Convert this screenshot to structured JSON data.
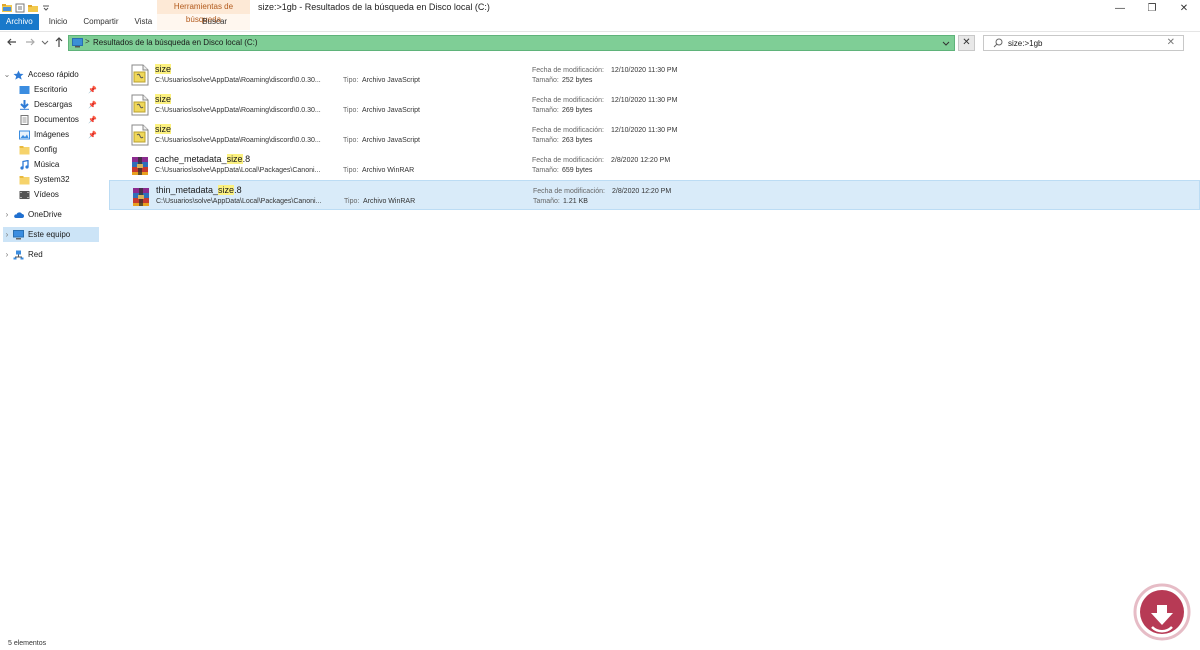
{
  "window": {
    "title": "size:>1gb - Resultados de la búsqueda en Disco local (C:)",
    "controls": [
      "—",
      "❐",
      "✕"
    ]
  },
  "ribbon": {
    "context_group": "Herramientas de búsqueda",
    "tabs": [
      "Archivo",
      "Inicio",
      "Compartir",
      "Vista",
      "Buscar"
    ]
  },
  "addressbar": {
    "path": "Resultados de la búsqueda en Disco local (C:)",
    "close_glyph": "✕"
  },
  "search": {
    "value": "size:>1gb",
    "clear_glyph": "✕"
  },
  "sidebar": {
    "items": [
      {
        "label": "Acceso rápido",
        "icon": "star-icon",
        "pinned": false
      },
      {
        "label": "Escritorio",
        "icon": "desktop-icon",
        "pinned": true
      },
      {
        "label": "Descargas",
        "icon": "download-icon",
        "pinned": true
      },
      {
        "label": "Documentos",
        "icon": "documents-icon",
        "pinned": true
      },
      {
        "label": "Imágenes",
        "icon": "pictures-icon",
        "pinned": true
      },
      {
        "label": "Config",
        "icon": "folder-icon",
        "pinned": false
      },
      {
        "label": "Música",
        "icon": "music-icon",
        "pinned": false
      },
      {
        "label": "System32",
        "icon": "folder-icon",
        "pinned": false
      },
      {
        "label": "Vídeos",
        "icon": "videos-icon",
        "pinned": false
      },
      {
        "label": "OneDrive",
        "icon": "cloud-icon",
        "pinned": false
      },
      {
        "label": "Este equipo",
        "icon": "computer-icon",
        "pinned": false
      },
      {
        "label": "Red",
        "icon": "network-icon",
        "pinned": false
      }
    ]
  },
  "results": {
    "type_label": "Tipo:",
    "date_label": "Fecha de modificación:",
    "size_label": "Tamaño:",
    "items": [
      {
        "name_pre": "",
        "name_hl": "size",
        "name_post": "",
        "path": "C:\\Usuarios\\solve\\AppData\\Roaming\\discord\\0.0.30...",
        "type": "Archivo JavaScript",
        "date": "12/10/2020 11:30 PM",
        "size": "252 bytes",
        "icon": "javascript-file-icon"
      },
      {
        "name_pre": "",
        "name_hl": "size",
        "name_post": "",
        "path": "C:\\Usuarios\\solve\\AppData\\Roaming\\discord\\0.0.30...",
        "type": "Archivo JavaScript",
        "date": "12/10/2020 11:30 PM",
        "size": "269 bytes",
        "icon": "javascript-file-icon"
      },
      {
        "name_pre": "",
        "name_hl": "size",
        "name_post": "",
        "path": "C:\\Usuarios\\solve\\AppData\\Roaming\\discord\\0.0.30...",
        "type": "Archivo JavaScript",
        "date": "12/10/2020 11:30 PM",
        "size": "263 bytes",
        "icon": "javascript-file-icon"
      },
      {
        "name_pre": "cache_metadata_",
        "name_hl": "size",
        "name_post": ".8",
        "path": "C:\\Usuarios\\solve\\AppData\\Local\\Packages\\Canoni...",
        "type": "Archivo WinRAR",
        "date": "2/8/2020 12:20 PM",
        "size": "659 bytes",
        "icon": "winrar-file-icon"
      },
      {
        "name_pre": "thin_metadata_",
        "name_hl": "size",
        "name_post": ".8",
        "path": "C:\\Usuarios\\solve\\AppData\\Local\\Packages\\Canoni...",
        "type": "Archivo WinRAR",
        "date": "2/8/2020 12:20 PM",
        "size": "1.21 KB",
        "icon": "winrar-file-icon"
      }
    ]
  },
  "status": {
    "count": "5 elementos"
  },
  "colors": {
    "accent": "#1979ca",
    "address_progress": "#7fce96",
    "highlight": "#fcf180",
    "selected_row": "#d9ebf9",
    "context_tab": "#fde9d6"
  }
}
